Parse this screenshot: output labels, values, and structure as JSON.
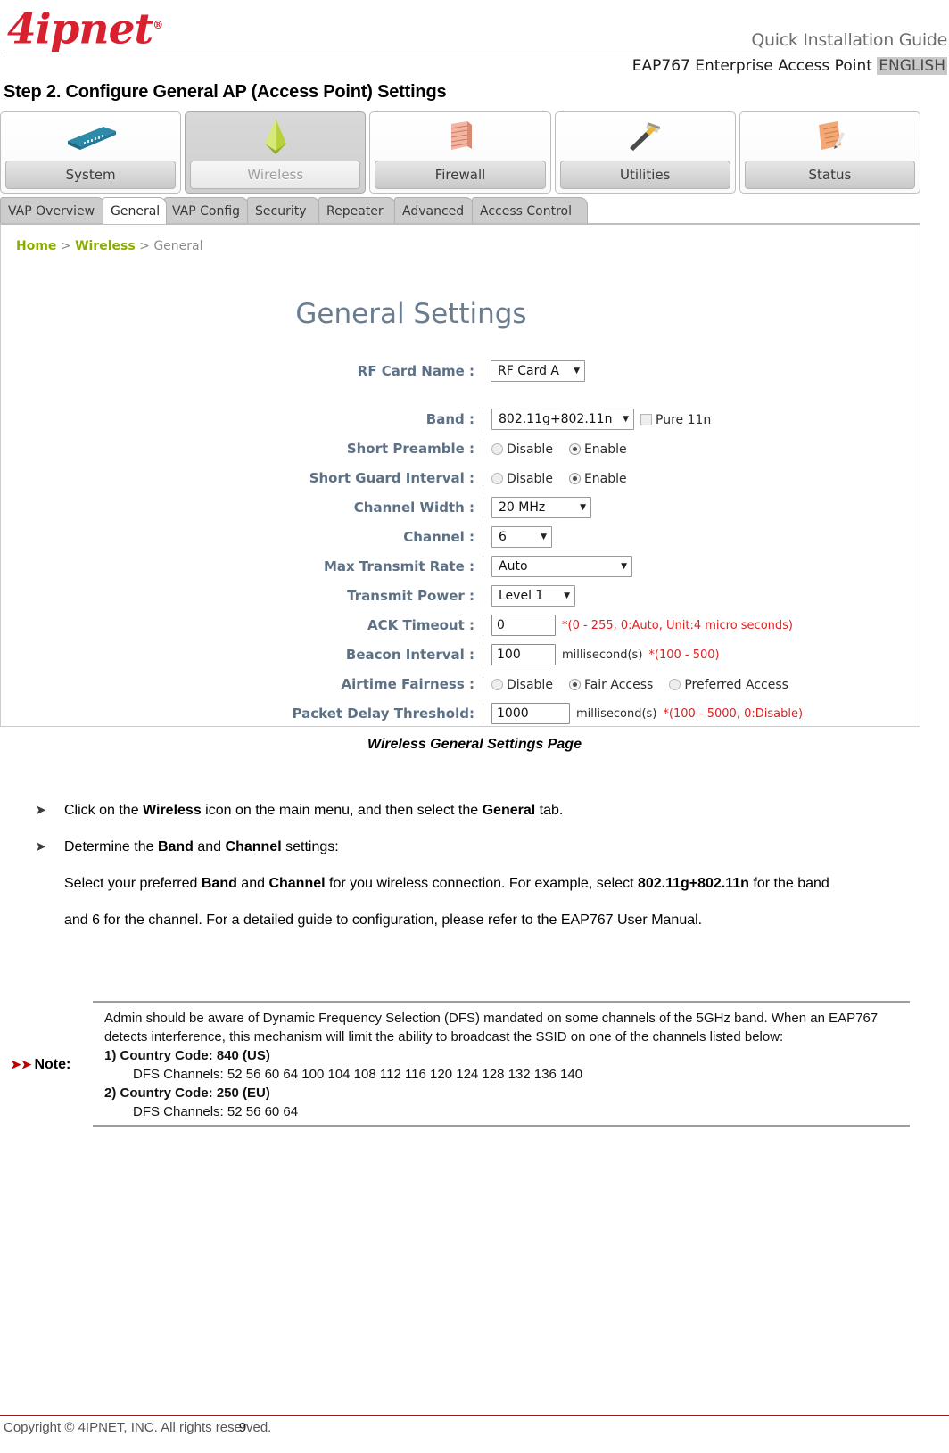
{
  "header": {
    "logo_text": "4ipnet",
    "logo_reg": "®",
    "guide_title": "Quick Installation Guide",
    "product_line": "EAP767 Enterprise Access Point",
    "language": "ENGLISH"
  },
  "step_title": "Step 2. Configure General AP (Access Point) Settings",
  "screenshot": {
    "main_menu": [
      {
        "label": "System",
        "icon": "router-device-icon",
        "active": false
      },
      {
        "label": "Wireless",
        "icon": "antenna-beam-icon",
        "active": true
      },
      {
        "label": "Firewall",
        "icon": "brick-wall-icon",
        "active": false
      },
      {
        "label": "Utilities",
        "icon": "hammer-icon",
        "active": false
      },
      {
        "label": "Status",
        "icon": "document-pencil-icon",
        "active": false
      }
    ],
    "sub_tabs": [
      {
        "label": "VAP Overview",
        "active": false
      },
      {
        "label": "General",
        "active": true
      },
      {
        "label": "VAP Config",
        "active": false
      },
      {
        "label": "Security",
        "active": false
      },
      {
        "label": "Repeater",
        "active": false
      },
      {
        "label": "Advanced",
        "active": false
      },
      {
        "label": "Access Control",
        "active": false
      }
    ],
    "breadcrumb": {
      "home": "Home",
      "sep1": " > ",
      "section": "Wireless",
      "sep2": " > ",
      "page": "General"
    },
    "panel_title": "General Settings",
    "fields": {
      "rf_card_name": {
        "label": "RF Card Name :",
        "value": "RF Card A"
      },
      "band": {
        "label": "Band :",
        "value": "802.11g+802.11n",
        "pure11n_label": "Pure 11n",
        "pure11n_checked": false
      },
      "short_preamble": {
        "label": "Short Preamble :",
        "option_disable": "Disable",
        "option_enable": "Enable",
        "selected": "Enable"
      },
      "short_guard_interval": {
        "label": "Short Guard Interval :",
        "option_disable": "Disable",
        "option_enable": "Enable",
        "selected": "Enable"
      },
      "channel_width": {
        "label": "Channel Width :",
        "value": "20 MHz"
      },
      "channel": {
        "label": "Channel :",
        "value": "6"
      },
      "max_transmit_rate": {
        "label": "Max Transmit Rate :",
        "value": "Auto"
      },
      "transmit_power": {
        "label": "Transmit Power :",
        "value": "Level 1"
      },
      "ack_timeout": {
        "label": "ACK Timeout :",
        "value": "0",
        "hint": "*(0 - 255, 0:Auto, Unit:4 micro seconds)"
      },
      "beacon_interval": {
        "label": "Beacon Interval :",
        "value": "100",
        "unit": "millisecond(s)",
        "hint": "*(100 - 500)"
      },
      "airtime_fairness": {
        "label": "Airtime Fairness :",
        "option_disable": "Disable",
        "option_fair": "Fair Access",
        "option_preferred": "Preferred Access",
        "selected": "Fair Access"
      },
      "packet_delay_threshold": {
        "label": "Packet Delay Threshold:",
        "value": "1000",
        "unit": "millisecond(s)",
        "hint": "*(100 - 5000, 0:Disable)"
      }
    }
  },
  "figure_caption": "Wireless General Settings Page",
  "bullets": [
    {
      "marker": "➤",
      "parts": [
        {
          "t": "Click on the ",
          "b": false
        },
        {
          "t": "Wireless",
          "b": true
        },
        {
          "t": " icon on the main menu, and then select the ",
          "b": false
        },
        {
          "t": "General",
          "b": true
        },
        {
          "t": " tab.",
          "b": false
        }
      ]
    },
    {
      "marker": "➤",
      "parts": [
        {
          "t": "Determine the ",
          "b": false
        },
        {
          "t": "Band",
          "b": true
        },
        {
          "t": " and ",
          "b": false
        },
        {
          "t": "Channel",
          "b": true
        },
        {
          "t": " settings:",
          "b": false
        }
      ]
    }
  ],
  "paragraph": [
    {
      "t": "Select your preferred ",
      "b": false
    },
    {
      "t": "Band",
      "b": true
    },
    {
      "t": " and ",
      "b": false
    },
    {
      "t": "Channel",
      "b": true
    },
    {
      "t": " for you wireless connection. For example, select ",
      "b": false
    },
    {
      "t": "802.11g+802.11n",
      "b": true
    },
    {
      "t": " for the band and 6 for the channel. For a detailed guide to configuration, please refer to the EAP767 User Manual.",
      "b": false
    }
  ],
  "note": {
    "label": "Note:",
    "arrow": "➤➤",
    "intro": "Admin should be aware of Dynamic Frequency Selection (DFS) mandated on some channels of the 5GHz band. When an EAP767 detects interference, this mechanism will limit the ability to broadcast the SSID on one of the channels listed below:",
    "items": [
      {
        "title": "1) Country Code: 840 (US)",
        "channels": "DFS Channels: 52 56 60 64 100 104 108 112 116 120 124 128 132 136 140"
      },
      {
        "title": "2) Country Code: 250 (EU)",
        "channels": "DFS Channels: 52 56 60 64"
      }
    ]
  },
  "footer": {
    "copyright": "Copyright © 4IPNET, INC. All rights reserved.",
    "page_number": "9"
  },
  "colors": {
    "brand_red": "#d8202f",
    "footer_rule": "#9b1a1a",
    "crumb_green": "#8aae00",
    "panel_title": "#6a7d90",
    "label_blue": "#5d7186",
    "hint_red": "#e02020"
  }
}
